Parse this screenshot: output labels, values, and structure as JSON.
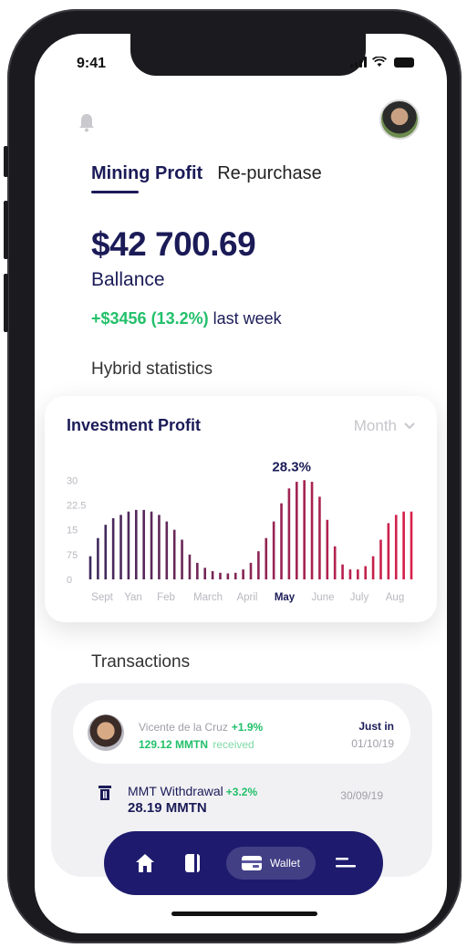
{
  "status_bar": {
    "time": "9:41"
  },
  "tabs": [
    {
      "label": "Mining Profit",
      "active": true
    },
    {
      "label": "Re-purchase",
      "active": false
    }
  ],
  "balance": {
    "amount": "$42 700.69",
    "label": "Ballance",
    "change_value": "+$3456 (13.2%)",
    "change_suffix": "last week"
  },
  "section_stats": "Hybrid statistics",
  "investment_card": {
    "title": "Investment Profit",
    "period_selector": "Month"
  },
  "chart_data": {
    "type": "bar",
    "title": "Investment Profit",
    "categories": [
      "Sept",
      "Yan",
      "Feb",
      "March",
      "April",
      "May",
      "June",
      "July",
      "Aug"
    ],
    "highlighted_category": "May",
    "y_tick_labels": [
      "0",
      "75",
      "15",
      "22.5",
      "30"
    ],
    "y_ticks": [
      0,
      7.5,
      15,
      22.5,
      30
    ],
    "ylim": [
      0,
      32
    ],
    "peak_label": "28.3%",
    "grid": false,
    "values": [
      7,
      12.5,
      16.5,
      18.5,
      19.5,
      20.5,
      21,
      21,
      20.5,
      19.5,
      17.5,
      15,
      12,
      7.5,
      5,
      3.5,
      2.5,
      2,
      1.8,
      2,
      3,
      5,
      8.5,
      12.5,
      17.5,
      23,
      27.5,
      29.5,
      30,
      29.5,
      25,
      18,
      10,
      4.5,
      3,
      3,
      4,
      7,
      12,
      17,
      19.5,
      20.5,
      20.5
    ],
    "gradient_colors": [
      "#3d2a5e",
      "#d81f4a"
    ]
  },
  "transactions": {
    "title": "Transactions",
    "items": [
      {
        "name": "Vicente de la Cruz",
        "percent": "+1.9%",
        "amount": "129.12 MMTN",
        "status": "received",
        "when": "Just in",
        "date": "01/10/19"
      },
      {
        "name": "MMT Withdrawal",
        "percent": "+3.2%",
        "amount": "28.19 MMTN",
        "date": "30/09/19"
      }
    ]
  },
  "bottom_nav": {
    "items": [
      {
        "icon": "home-icon"
      },
      {
        "icon": "card-icon"
      },
      {
        "icon": "wallet-icon",
        "label": "Wallet",
        "active": true
      },
      {
        "icon": "menu-icon"
      }
    ]
  },
  "colors": {
    "primary": "#1e1b6e",
    "text_dark": "#1b1b58",
    "positive": "#22c06a",
    "muted": "#9e9ea8"
  }
}
